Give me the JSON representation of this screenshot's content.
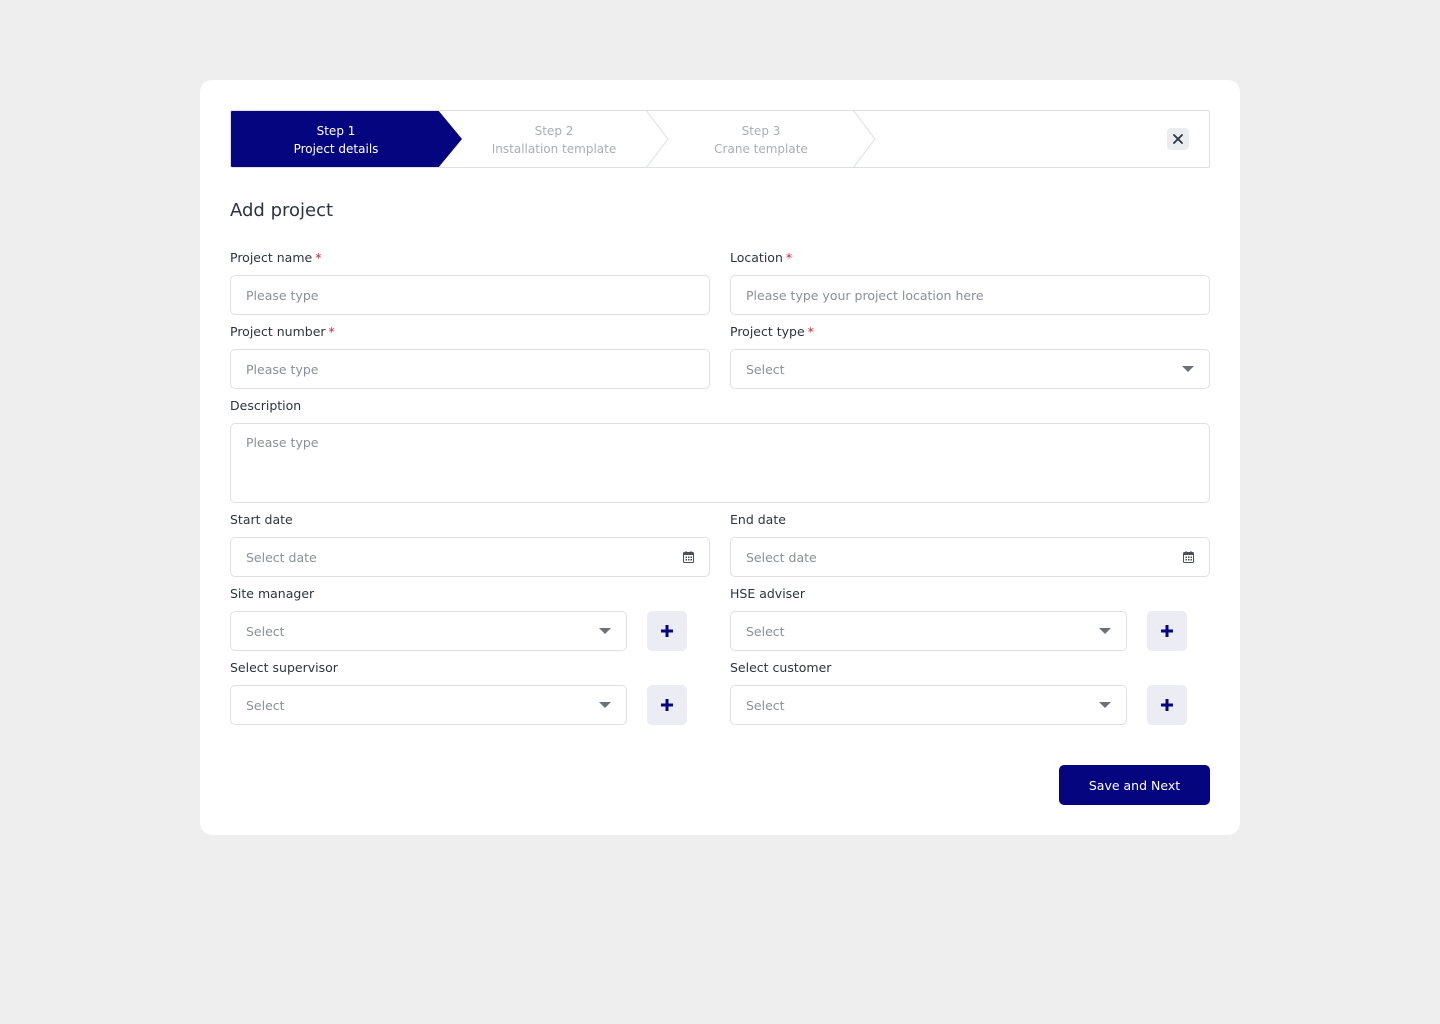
{
  "stepper": {
    "steps": [
      {
        "step": "Step 1",
        "label": "Project details",
        "active": true
      },
      {
        "step": "Step 2",
        "label": "Installation template",
        "active": false
      },
      {
        "step": "Step 3",
        "label": "Crane template",
        "active": false
      }
    ],
    "close_icon": "close-icon"
  },
  "form": {
    "title": "Add project",
    "required_mark": "*",
    "project_name": {
      "label": "Project name",
      "placeholder": "Please type"
    },
    "location": {
      "label": "Location",
      "placeholder": "Please type your project location here"
    },
    "project_number": {
      "label": "Project number",
      "placeholder": "Please type"
    },
    "project_type": {
      "label": "Project type",
      "value": "Select"
    },
    "description": {
      "label": "Description",
      "placeholder": "Please type"
    },
    "start_date": {
      "label": "Start date",
      "placeholder": "Select date"
    },
    "end_date": {
      "label": "End date",
      "placeholder": "Select date"
    },
    "site_manager": {
      "label": "Site manager",
      "value": "Select"
    },
    "hse_adviser": {
      "label": "HSE adviser",
      "value": "Select"
    },
    "supervisor": {
      "label": "Select supervisor",
      "value": "Select"
    },
    "customer": {
      "label": "Select customer",
      "value": "Select"
    }
  },
  "actions": {
    "save_next": "Save and Next"
  },
  "colors": {
    "primary": "#05067f",
    "required": "#e11d2a",
    "background": "#eeeeee",
    "plus_bg": "#ebecf4"
  }
}
